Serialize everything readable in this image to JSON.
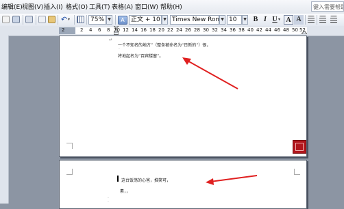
{
  "menu": {
    "items": [
      "编辑(E)",
      "视图(V)",
      "插入(I)",
      "格式(O)",
      "工具(T)",
      "表格(A)",
      "窗口(W)",
      "帮助(H)"
    ],
    "help_placeholder": "键入需要帮助"
  },
  "toolbar": {
    "zoom": "75%",
    "style": "正文 + 10 ł",
    "font": "Times New Roma",
    "size": "10",
    "bold": "B",
    "italic": "I",
    "underline": "U",
    "font_color": "A",
    "highlight": "A"
  },
  "ruler": {
    "ticks": [
      "2",
      "2",
      "4",
      "6",
      "8",
      "10",
      "12",
      "14",
      "16",
      "18",
      "20",
      "22",
      "24",
      "26",
      "28",
      "30",
      "32",
      "34",
      "36",
      "38",
      "40",
      "42",
      "44",
      "46",
      "48",
      "50",
      "52"
    ]
  },
  "document": {
    "page1": {
      "line1": "一个不知名的地方”（整条被命名为“日新的”）很，",
      "line2": "将地起名为“百宾楼窗”。"
    },
    "page2": {
      "line1": "这台饭荡的心爸，推笑可，",
      "line2": "素，，"
    }
  },
  "colors": {
    "annotation_arrow": "#e02020",
    "workspace": "#8c95a3",
    "seal": "#b0161c"
  },
  "icons": [
    "new-document-icon",
    "print-icon",
    "preview-icon",
    "copy-icon",
    "paste-icon",
    "undo-icon",
    "table-icon",
    "align-left-icon",
    "align-center-icon",
    "list-icon"
  ]
}
